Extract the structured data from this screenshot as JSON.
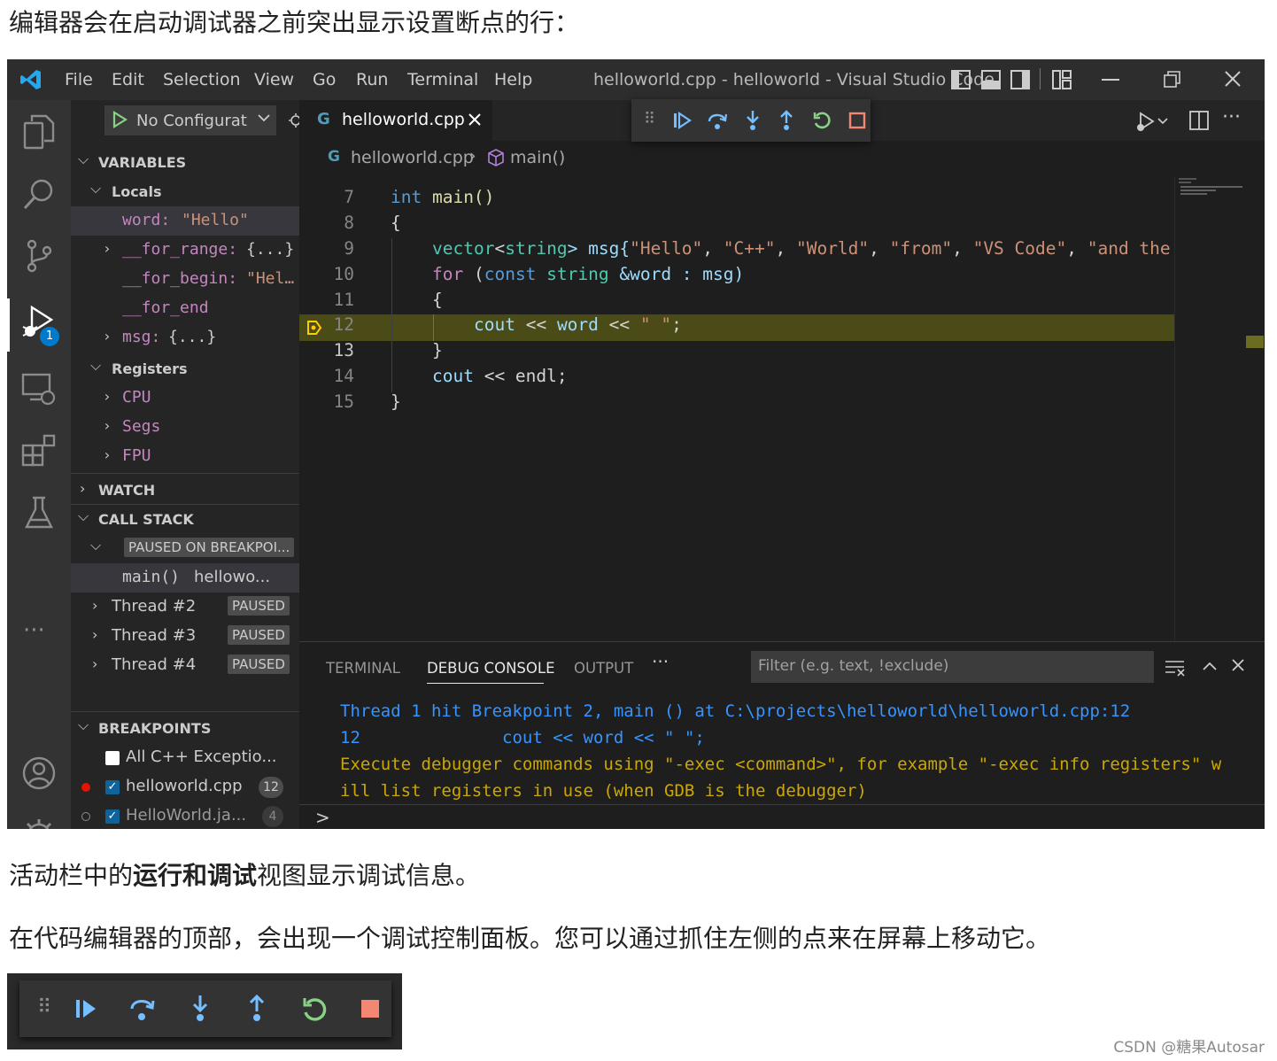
{
  "article": {
    "intro": "编辑器会在启动调试器之前突出显示设置断点的行：",
    "para2_pre": "活动栏中的",
    "para2_bold": "运行和调试",
    "para2_post": "视图显示调试信息。",
    "para3": "在代码编辑器的顶部，会出现一个调试控制面板。您可以通过抓住左侧的点来在屏幕上移动它。",
    "watermark": "CSDN @糖果Autosar"
  },
  "titlebar": {
    "menus": [
      "File",
      "Edit",
      "Selection",
      "View",
      "Go",
      "Run",
      "Terminal",
      "Help"
    ],
    "window_title": "helloworld.cpp - helloworld - Visual Studio Code"
  },
  "activitybar": {
    "debug_badge": "1",
    "more": "···"
  },
  "sidebar": {
    "run_config": "No Configurat",
    "variables_header": "VARIABLES",
    "locals_header": "Locals",
    "locals": [
      {
        "name": "word:",
        "value": "\"Hello\""
      },
      {
        "name": "__for_range:",
        "value": "{...}"
      },
      {
        "name": "__for_begin:",
        "value": "\"Hel…"
      },
      {
        "name": "__for_end",
        "value": ""
      },
      {
        "name": "msg:",
        "value": "{...}"
      }
    ],
    "registers_header": "Registers",
    "registers": [
      "CPU",
      "Segs",
      "FPU"
    ],
    "watch_header": "WATCH",
    "callstack_header": "CALL STACK",
    "paused_label": "PAUSED ON BREAKPOI...",
    "frame_name": "main()",
    "frame_file": "hellowo...",
    "threads": [
      {
        "name": "Thread #2",
        "state": "PAUSED"
      },
      {
        "name": "Thread #3",
        "state": "PAUSED"
      },
      {
        "name": "Thread #4",
        "state": "PAUSED"
      }
    ],
    "breakpoints_header": "BREAKPOINTS",
    "breakpoints": [
      {
        "label": "All C++ Exceptio...",
        "checked": false,
        "count": ""
      },
      {
        "label": "helloworld.cpp",
        "checked": true,
        "count": "12"
      },
      {
        "label": "HelloWorld.ja...",
        "checked": true,
        "count": "4"
      }
    ]
  },
  "editor": {
    "tab_label": "helloworld.cpp",
    "breadcrumb_file": "helloworld.cpp",
    "breadcrumb_symbol": "main()",
    "line_numbers": [
      "7",
      "8",
      "9",
      "10",
      "11",
      "12",
      "13",
      "14",
      "15"
    ],
    "code": {
      "l7_kw": "int",
      "l7_rest": " main()",
      "l8": "{",
      "l9_a": "vector",
      "l9_b": "<",
      "l9_c": "string",
      "l9_d": "> msg{",
      "l9_s1": "\"Hello\"",
      "l9_s2": "\"C++\"",
      "l9_s3": "\"World\"",
      "l9_s4": "\"from\"",
      "l9_s5": "\"VS Code\"",
      "l9_s6": "\"and the",
      "l10_for": "for",
      "l10_a": " (",
      "l10_const": "const",
      "l10_string": "string",
      "l10_rest": " &word : msg)",
      "l11": "{",
      "l12_a": "cout",
      "l12_b": " << ",
      "l12_c": "word",
      "l12_d": " << ",
      "l12_s": "\" \"",
      "l12_e": ";",
      "l13": "}",
      "l14_a": "cout",
      "l14_b": " << endl;",
      "l15": "}"
    }
  },
  "panel": {
    "tabs": [
      "TERMINAL",
      "DEBUG CONSOLE",
      "OUTPUT"
    ],
    "more": "···",
    "filter_placeholder": "Filter (e.g. text, !exclude)",
    "console": [
      "Thread 1 hit Breakpoint 2, main () at C:\\projects\\helloworld\\helloworld.cpp:12",
      "12              cout << word << \" \";",
      "Execute debugger commands using \"-exec <command>\", for example \"-exec info registers\" w",
      "ill list registers in use (when GDB is the debugger)"
    ],
    "prompt": ">"
  },
  "colors": {
    "accent": "#007acc",
    "highlight_line": "#4b4b18",
    "console_blue": "#3794ff",
    "console_yellow": "#cca700",
    "debug_green": "#89d185",
    "debug_blue": "#75beff",
    "debug_red": "#f48771",
    "breakpoint_red": "#e51400"
  }
}
